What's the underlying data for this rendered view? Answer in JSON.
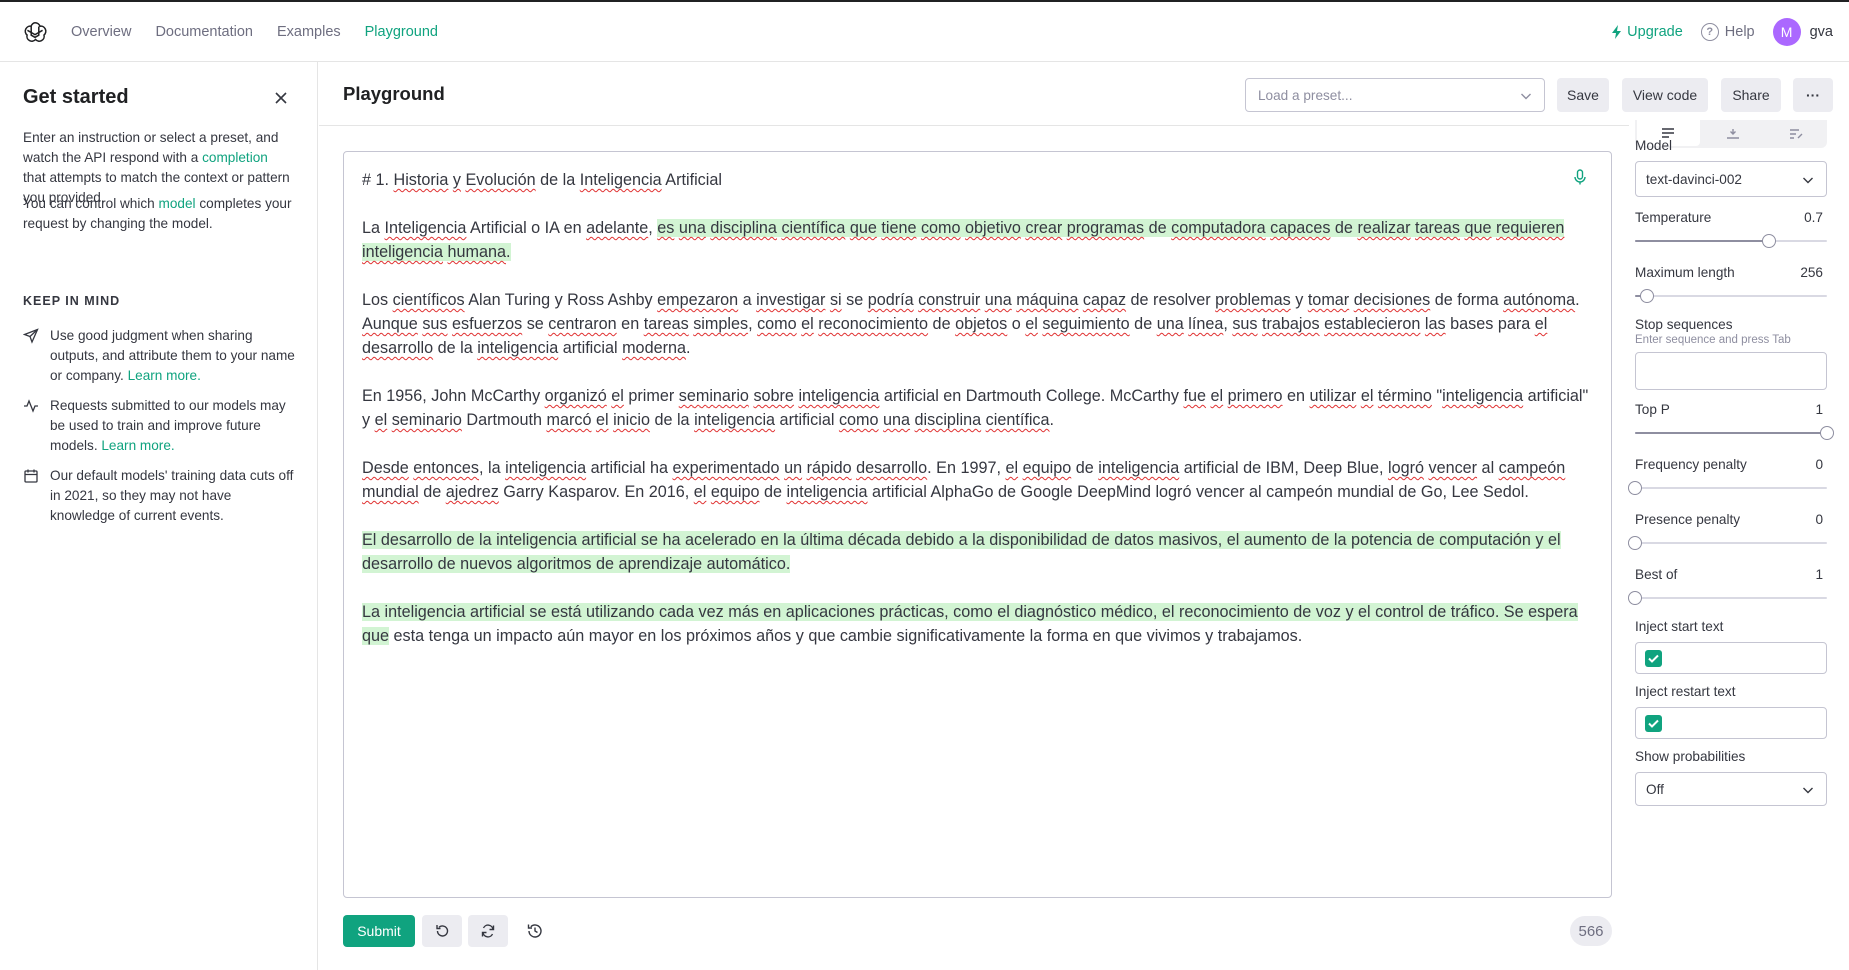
{
  "nav": {
    "links": [
      "Overview",
      "Documentation",
      "Examples",
      "Playground"
    ],
    "upgrade": "Upgrade",
    "help": "Help",
    "avatar_initial": "M",
    "username": "gva"
  },
  "sidebar": {
    "title": "Get started",
    "intro_pre": "Enter an instruction or select a preset, and watch the API respond with a ",
    "intro_link": "completion",
    "intro_post": " that attempts to match the context or pattern you provided.",
    "model_pre": "You can control which ",
    "model_link": "model",
    "model_post": " completes your request by changing the model.",
    "keep_in_mind": "KEEP IN MIND",
    "tips": [
      {
        "text": "Use good judgment when sharing outputs, and attribute them to your name or company. ",
        "link": "Learn more."
      },
      {
        "text": "Requests submitted to our models may be used to train and improve future models. ",
        "link": "Learn more."
      },
      {
        "text": "Our default models' training data cuts off in 2021, so they may not have knowledge of current events.",
        "link": ""
      }
    ]
  },
  "header": {
    "title": "Playground",
    "preset_placeholder": "Load a preset...",
    "save": "Save",
    "view_code": "View code",
    "share": "Share",
    "more": "···"
  },
  "editor": {
    "paragraphs": [
      [
        {
          "t": "# 1. "
        },
        {
          "t": "Historia",
          "s": 1
        },
        {
          "t": " "
        },
        {
          "t": "y",
          "s": 1
        },
        {
          "t": " "
        },
        {
          "t": "Evolución",
          "s": 1
        },
        {
          "t": " de la "
        },
        {
          "t": "Inteligencia",
          "s": 1
        },
        {
          "t": " Artificial"
        }
      ],
      [
        {
          "t": "La "
        },
        {
          "t": "Inteligencia",
          "s": 1
        },
        {
          "t": " Artificial o IA en "
        },
        {
          "t": "adelante",
          "s": 1
        },
        {
          "t": ", "
        },
        {
          "t": "es",
          "s": 1,
          "h": 1
        },
        {
          "t": " ",
          "h": 1
        },
        {
          "t": "una",
          "s": 1,
          "h": 1
        },
        {
          "t": " ",
          "h": 1
        },
        {
          "t": "disciplina",
          "s": 1,
          "h": 1
        },
        {
          "t": " ",
          "h": 1
        },
        {
          "t": "científica",
          "s": 1,
          "h": 1
        },
        {
          "t": " ",
          "h": 1
        },
        {
          "t": "que",
          "s": 1,
          "h": 1
        },
        {
          "t": " ",
          "h": 1
        },
        {
          "t": "tiene",
          "s": 1,
          "h": 1
        },
        {
          "t": " ",
          "h": 1
        },
        {
          "t": "como",
          "s": 1,
          "h": 1
        },
        {
          "t": " ",
          "h": 1
        },
        {
          "t": "objetivo",
          "s": 1,
          "h": 1
        },
        {
          "t": " ",
          "h": 1
        },
        {
          "t": "crear",
          "s": 1,
          "h": 1
        },
        {
          "t": " ",
          "h": 1
        },
        {
          "t": "programas",
          "s": 1,
          "h": 1
        },
        {
          "t": " de ",
          "h": 1
        },
        {
          "t": "computadora",
          "s": 1,
          "h": 1
        },
        {
          "t": " ",
          "h": 1
        },
        {
          "t": "capaces",
          "s": 1,
          "h": 1
        },
        {
          "t": " de ",
          "h": 1
        },
        {
          "t": "realizar",
          "s": 1,
          "h": 1
        },
        {
          "t": " ",
          "h": 1
        },
        {
          "t": "tareas",
          "s": 1,
          "h": 1
        },
        {
          "t": " ",
          "h": 1
        },
        {
          "t": "que",
          "s": 1,
          "h": 1
        },
        {
          "t": " ",
          "h": 1
        },
        {
          "t": "requieren",
          "s": 1,
          "h": 1
        },
        {
          "t": " ",
          "h": 1
        },
        {
          "t": "inteligencia",
          "s": 1,
          "h": 1
        },
        {
          "t": " ",
          "h": 1
        },
        {
          "t": "humana",
          "s": 1,
          "h": 1
        },
        {
          "t": ".",
          "h": 1
        }
      ],
      [
        {
          "t": "Los "
        },
        {
          "t": "científicos",
          "s": 1
        },
        {
          "t": " Alan Turing y Ross Ashby "
        },
        {
          "t": "empezaron",
          "s": 1
        },
        {
          "t": " a "
        },
        {
          "t": "investigar",
          "s": 1
        },
        {
          "t": " "
        },
        {
          "t": "si",
          "s": 1
        },
        {
          "t": " se "
        },
        {
          "t": "podría",
          "s": 1
        },
        {
          "t": " "
        },
        {
          "t": "construir",
          "s": 1
        },
        {
          "t": " "
        },
        {
          "t": "una",
          "s": 1
        },
        {
          "t": " "
        },
        {
          "t": "máquina",
          "s": 1
        },
        {
          "t": " "
        },
        {
          "t": "capaz",
          "s": 1
        },
        {
          "t": " de resolver "
        },
        {
          "t": "problemas",
          "s": 1
        },
        {
          "t": " y "
        },
        {
          "t": "tomar",
          "s": 1
        },
        {
          "t": " "
        },
        {
          "t": "decisiones",
          "s": 1
        },
        {
          "t": " de forma "
        },
        {
          "t": "autónoma",
          "s": 1
        },
        {
          "t": ". "
        },
        {
          "t": "Aunque",
          "s": 1
        },
        {
          "t": " "
        },
        {
          "t": "sus",
          "s": 1
        },
        {
          "t": " "
        },
        {
          "t": "esfuerzos",
          "s": 1
        },
        {
          "t": " se "
        },
        {
          "t": "centraron",
          "s": 1
        },
        {
          "t": " en "
        },
        {
          "t": "tareas",
          "s": 1
        },
        {
          "t": " "
        },
        {
          "t": "simples",
          "s": 1
        },
        {
          "t": ", "
        },
        {
          "t": "como",
          "s": 1
        },
        {
          "t": " "
        },
        {
          "t": "el",
          "s": 1
        },
        {
          "t": " "
        },
        {
          "t": "reconocimiento",
          "s": 1
        },
        {
          "t": " de "
        },
        {
          "t": "objetos",
          "s": 1
        },
        {
          "t": " o "
        },
        {
          "t": "el",
          "s": 1
        },
        {
          "t": " "
        },
        {
          "t": "seguimiento",
          "s": 1
        },
        {
          "t": " de "
        },
        {
          "t": "una",
          "s": 1
        },
        {
          "t": " "
        },
        {
          "t": "línea",
          "s": 1
        },
        {
          "t": ", "
        },
        {
          "t": "sus",
          "s": 1
        },
        {
          "t": " "
        },
        {
          "t": "trabajos",
          "s": 1
        },
        {
          "t": " "
        },
        {
          "t": "establecieron",
          "s": 1
        },
        {
          "t": " "
        },
        {
          "t": "las",
          "s": 1
        },
        {
          "t": " bases para "
        },
        {
          "t": "el",
          "s": 1
        },
        {
          "t": " "
        },
        {
          "t": "desarrollo",
          "s": 1
        },
        {
          "t": " de la "
        },
        {
          "t": "inteligencia",
          "s": 1
        },
        {
          "t": " artificial "
        },
        {
          "t": "moderna",
          "s": 1
        },
        {
          "t": "."
        }
      ],
      [
        {
          "t": "En 1956, John McCarthy "
        },
        {
          "t": "organizó",
          "s": 1
        },
        {
          "t": " "
        },
        {
          "t": "el",
          "s": 1
        },
        {
          "t": " primer "
        },
        {
          "t": "seminario",
          "s": 1
        },
        {
          "t": " "
        },
        {
          "t": "sobre",
          "s": 1
        },
        {
          "t": " "
        },
        {
          "t": "inteligencia",
          "s": 1
        },
        {
          "t": " artificial en Dartmouth College. McCarthy "
        },
        {
          "t": "fue",
          "s": 1
        },
        {
          "t": " "
        },
        {
          "t": "el",
          "s": 1
        },
        {
          "t": " "
        },
        {
          "t": "primero",
          "s": 1
        },
        {
          "t": " en "
        },
        {
          "t": "utilizar",
          "s": 1
        },
        {
          "t": " "
        },
        {
          "t": "el",
          "s": 1
        },
        {
          "t": " "
        },
        {
          "t": "término",
          "s": 1
        },
        {
          "t": " \""
        },
        {
          "t": "inteligencia",
          "s": 1
        },
        {
          "t": " artificial\" y "
        },
        {
          "t": "el",
          "s": 1
        },
        {
          "t": " "
        },
        {
          "t": "seminario",
          "s": 1
        },
        {
          "t": " Dartmouth "
        },
        {
          "t": "marcó",
          "s": 1
        },
        {
          "t": " "
        },
        {
          "t": "el",
          "s": 1
        },
        {
          "t": " "
        },
        {
          "t": "inicio",
          "s": 1
        },
        {
          "t": " de la "
        },
        {
          "t": "inteligencia",
          "s": 1
        },
        {
          "t": " artificial "
        },
        {
          "t": "como",
          "s": 1
        },
        {
          "t": " "
        },
        {
          "t": "una",
          "s": 1
        },
        {
          "t": " "
        },
        {
          "t": "disciplina",
          "s": 1
        },
        {
          "t": " "
        },
        {
          "t": "científica",
          "s": 1
        },
        {
          "t": "."
        }
      ],
      [
        {
          "t": "Desde",
          "s": 1
        },
        {
          "t": " "
        },
        {
          "t": "entonces",
          "s": 1
        },
        {
          "t": ", la "
        },
        {
          "t": "inteligencia",
          "s": 1
        },
        {
          "t": " artificial ha "
        },
        {
          "t": "experimentado",
          "s": 1
        },
        {
          "t": " "
        },
        {
          "t": "un",
          "s": 1
        },
        {
          "t": " "
        },
        {
          "t": "rápido",
          "s": 1
        },
        {
          "t": " "
        },
        {
          "t": "desarrollo",
          "s": 1
        },
        {
          "t": ". En 1997, "
        },
        {
          "t": "el",
          "s": 1
        },
        {
          "t": " "
        },
        {
          "t": "equipo",
          "s": 1
        },
        {
          "t": " de "
        },
        {
          "t": "inteligencia",
          "s": 1
        },
        {
          "t": " artificial de IBM, Deep Blue, "
        },
        {
          "t": "logró",
          "s": 1
        },
        {
          "t": " "
        },
        {
          "t": "vencer",
          "s": 1
        },
        {
          "t": " al "
        },
        {
          "t": "campeón",
          "s": 1
        },
        {
          "t": " "
        },
        {
          "t": "mundial",
          "s": 1
        },
        {
          "t": " de "
        },
        {
          "t": "ajedrez",
          "s": 1
        },
        {
          "t": " Garry Kasparov. En 2016, "
        },
        {
          "t": "el",
          "s": 1
        },
        {
          "t": " "
        },
        {
          "t": "equipo",
          "s": 1
        },
        {
          "t": " de "
        },
        {
          "t": "inteligencia",
          "s": 1
        },
        {
          "t": " artificial AlphaGo de Google DeepMind logró vencer al campeón mundial de Go, Lee Sedol."
        }
      ],
      [
        {
          "t": "El desarrollo de la inteligencia artificial se ha acelerado en la última década debido a la disponibilidad de datos masivos, el aumento de la potencia de computación y el desarrollo de nuevos algoritmos de aprendizaje automático.",
          "h": 1
        }
      ],
      [
        {
          "t": "La inteligencia artificial se está utilizando cada vez más en aplicaciones prácticas, como el diagnóstico médico, el reconocimiento de voz y el control de tráfico. Se espera que",
          "h": 1
        },
        {
          "t": " esta tenga un impacto aún mayor en los próximos años y que cambie significativamente la forma en que vivimos y trabajamos."
        }
      ]
    ]
  },
  "bottom": {
    "submit": "Submit",
    "token_count": "566"
  },
  "settings": {
    "model_label": "Model",
    "model_value": "text-davinci-002",
    "temperature_label": "Temperature",
    "temperature_value": "0.7",
    "temperature_fraction": 0.7,
    "max_length_label": "Maximum length",
    "max_length_value": "256",
    "max_length_fraction": 0.064,
    "stop_label": "Stop sequences",
    "stop_hint": "Enter sequence and press Tab",
    "top_p_label": "Top P",
    "top_p_value": "1",
    "top_p_fraction": 1.0,
    "freq_label": "Frequency penalty",
    "freq_value": "0",
    "freq_fraction": 0.0,
    "pres_label": "Presence penalty",
    "pres_value": "0",
    "pres_fraction": 0.0,
    "best_of_label": "Best of",
    "best_of_value": "1",
    "best_of_fraction": 0.0,
    "inject_start_label": "Inject start text",
    "inject_restart_label": "Inject restart text",
    "show_prob_label": "Show probabilities",
    "show_prob_value": "Off"
  },
  "colors": {
    "accent": "#10a37f",
    "highlight": "#d2f4d3",
    "avatar": "#ab68ff"
  }
}
